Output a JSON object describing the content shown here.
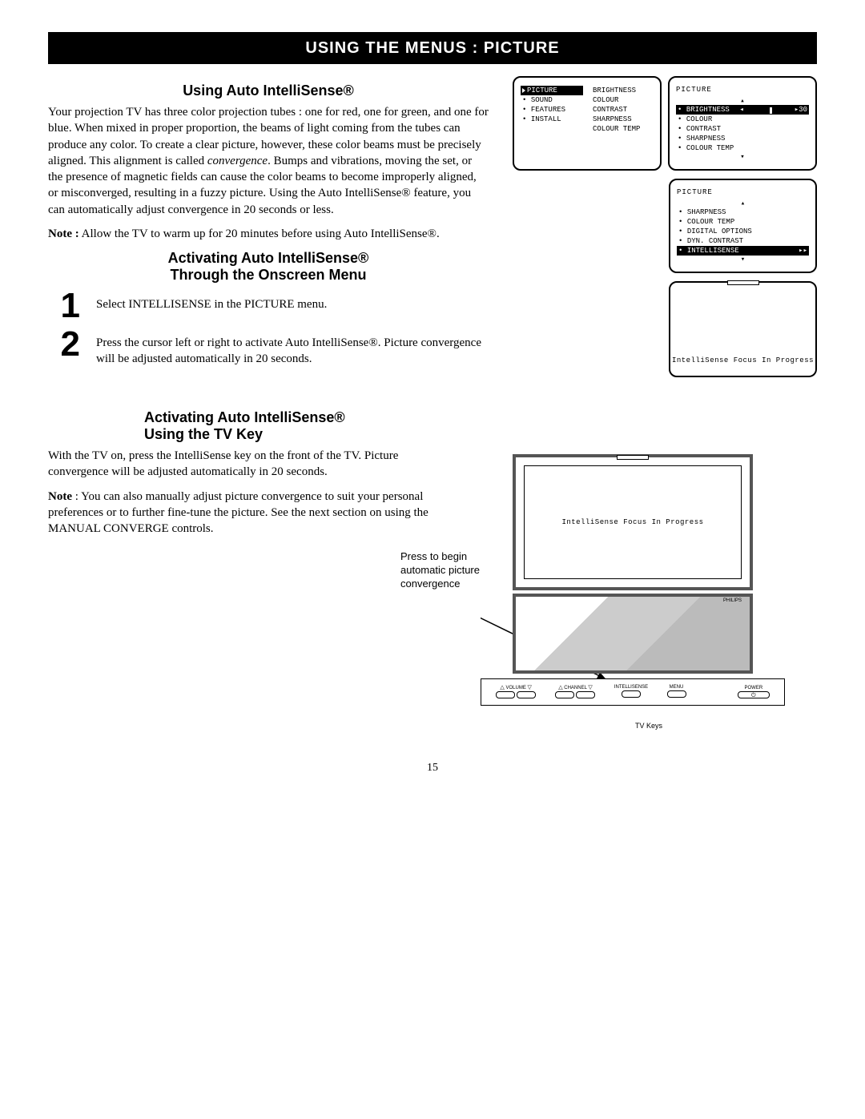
{
  "title_bar": "USING THE MENUS : PICTURE",
  "section1": {
    "heading": "Using Auto IntelliSense®",
    "para1_a": "Your projection TV has three color projection tubes : one for red, one for green, and one for blue. When mixed in proper proportion, the beams of light coming from the tubes can produce any color. To create a clear picture, however, these color beams must be precisely aligned. This alignment is called ",
    "para1_italic": "convergence",
    "para1_b": ". Bumps and vibrations, moving the set, or the presence of magnetic fields can cause the color beams to become improperly aligned, or misconverged, resulting in a fuzzy picture. Using the Auto IntelliSense® feature, you can automatically adjust convergence in 20 seconds or less.",
    "note_label": "Note :",
    "note_text": " Allow the TV to warm up for 20 minutes before using Auto IntelliSense®."
  },
  "section2": {
    "heading_line1": "Activating Auto IntelliSense®",
    "heading_line2": "Through the Onscreen Menu",
    "step1_num": "1",
    "step1_a": "Select ",
    "step1_b": "INTELLISENSE",
    "step1_c": " in the ",
    "step1_d": "PICTURE",
    "step1_e": " menu.",
    "step2_num": "2",
    "step2": "Press the cursor left or right to activate Auto IntelliSense®. Picture convergence will be adjusted automatically in 20 seconds."
  },
  "section3": {
    "heading_line1": "Activating Auto IntelliSense®",
    "heading_line2": "Using the TV Key",
    "para1": "With the TV on, press the IntelliSense key on the front of the TV. Picture convergence will be adjusted automatically in 20 seconds.",
    "note_label": "Note",
    "note_text": " : You can also manually adjust picture convergence to suit your personal preferences or to further fine-tune the picture. See the next section on using the MANUAL CONVERGE controls."
  },
  "osd1": {
    "left": [
      "PICTURE",
      "SOUND",
      "FEATURES",
      "INSTALL"
    ],
    "right": [
      "BRIGHTNESS",
      "COLOUR",
      "CONTRAST",
      "SHARPNESS",
      "COLOUR TEMP"
    ]
  },
  "osd2": {
    "title": "PICTURE",
    "items": [
      "BRIGHTNESS",
      "COLOUR",
      "CONTRAST",
      "SHARPNESS",
      "COLOUR TEMP"
    ],
    "value": "30"
  },
  "osd3": {
    "title": "PICTURE",
    "items": [
      "SHARPNESS",
      "COLOUR TEMP",
      "DIGITAL OPTIONS",
      "DYN. CONTRAST",
      "INTELLISENSE"
    ]
  },
  "osd4": {
    "text": "IntelliSense Focus In Progress"
  },
  "tv": {
    "screen_text": "IntelliSense Focus In Progress",
    "brand": "PHILIPS",
    "callout": "Press to begin automatic picture convergence",
    "keys_caption": "TV Keys",
    "labels": {
      "volume": "VOLUME",
      "channel": "CHANNEL",
      "intellisense": "INTELLISENSE",
      "menu": "MENU",
      "power": "POWER"
    }
  },
  "page_number": "15"
}
